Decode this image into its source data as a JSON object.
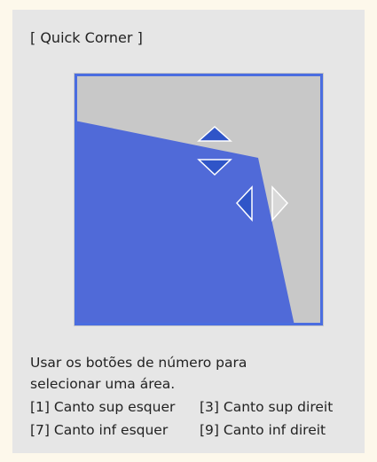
{
  "colors": {
    "page_bg": "#fdf8eb",
    "panel_bg": "#e6e6e6",
    "preview_frame": "#4a6de0",
    "image_fill": "#506ad8",
    "bg_fill": "#c8c8c8",
    "arrow_active": "#2f55c8",
    "arrow_inactive": "#d9d9d9"
  },
  "dialog": {
    "title": "[ Quick Corner ]"
  },
  "preview": {
    "arrows": {
      "up": "active",
      "down": "active",
      "left": "active",
      "right": "inactive"
    }
  },
  "help": {
    "line1": "Usar os botões de número para",
    "line2": "selecionar uma área.",
    "corner_1": "[1] Canto sup esquer",
    "corner_3": "[3] Canto sup direit",
    "corner_7": "[7] Canto inf esquer",
    "corner_9": "[9] Canto inf direit"
  }
}
